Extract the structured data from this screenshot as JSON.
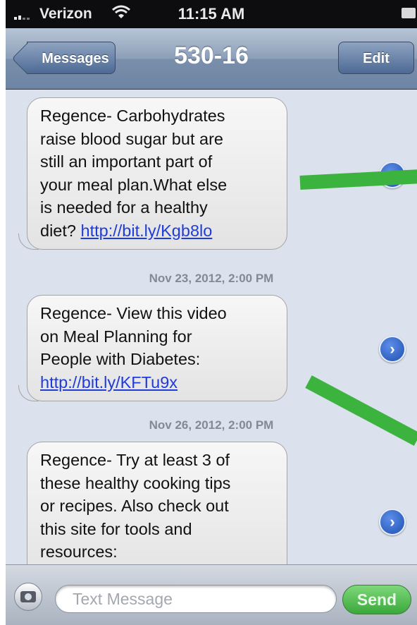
{
  "status_bar": {
    "carrier": "Verizon",
    "time": "11:15 AM"
  },
  "nav": {
    "back_label": "Messages",
    "title": "530-16",
    "edit_label": "Edit"
  },
  "messages": [
    {
      "lines": [
        "Regence- Carbohydrates",
        "raise blood sugar but are",
        "still an important part of",
        "your meal plan.What else",
        "is needed for a healthy"
      ],
      "prefix": "diet? ",
      "link": "http://bit.ly/Kgb8lo"
    },
    {
      "lines": [
        "Regence- View this video",
        "on Meal Planning for",
        "People with Diabetes:"
      ],
      "prefix": "",
      "link": "http://bit.ly/KFTu9x"
    },
    {
      "lines": [
        "Regence- Try at least 3 of",
        "these healthy cooking tips",
        "or recipes. Also check out",
        "this site for tools and",
        "resources:"
      ],
      "prefix": "",
      "link": ""
    }
  ],
  "timestamps": [
    "Nov 23, 2012, 2:00 PM",
    "Nov 26, 2012, 2:00 PM"
  ],
  "input": {
    "placeholder": "Text Message",
    "send_label": "Send"
  },
  "colors": {
    "nav": "#7a8fab",
    "background": "#dbe2ed",
    "link": "#1f3cd8",
    "send": "#3aa83a",
    "annotation": "#3db33f"
  },
  "icons": [
    "signal-icon",
    "wifi-icon",
    "battery-icon",
    "chevron-right-icon",
    "camera-icon"
  ]
}
